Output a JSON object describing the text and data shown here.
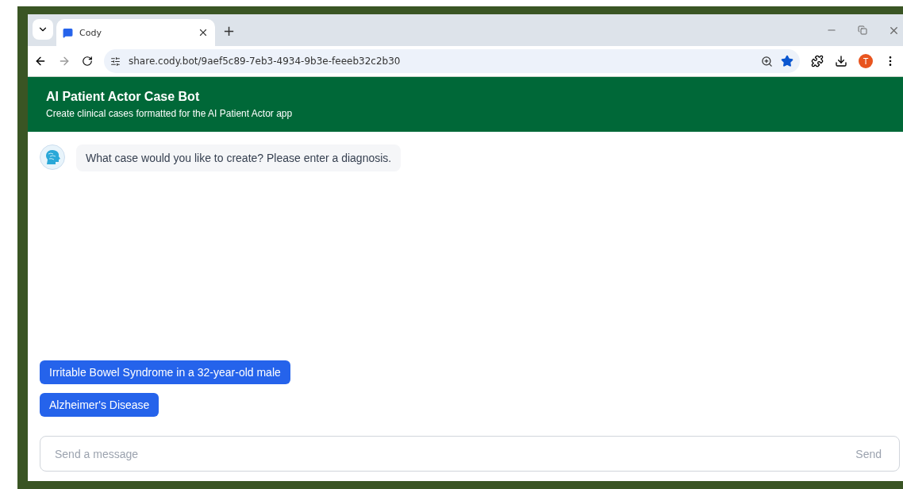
{
  "browser": {
    "tabs": [
      {
        "title": "Cody",
        "selected": true
      }
    ],
    "new_tab": "+",
    "url": "share.cody.bot/9aef5c89-7eb3-4934-9b3e-feeeb32c2b30",
    "bookmarked": true,
    "profile_initial": "T"
  },
  "app": {
    "title": "AI Patient Actor Case Bot",
    "subtitle": "Create clinical cases formatted for the AI Patient Actor app"
  },
  "messages": [
    {
      "kind": "bot",
      "text": "What case would you like to create? Please enter a diagnosis."
    }
  ],
  "suggestions": [
    "Irritable Bowel Syndrome in a 32-year-old male",
    "Alzheimer's Disease"
  ],
  "composer": {
    "placeholder": "Send a message",
    "send": "Send"
  }
}
